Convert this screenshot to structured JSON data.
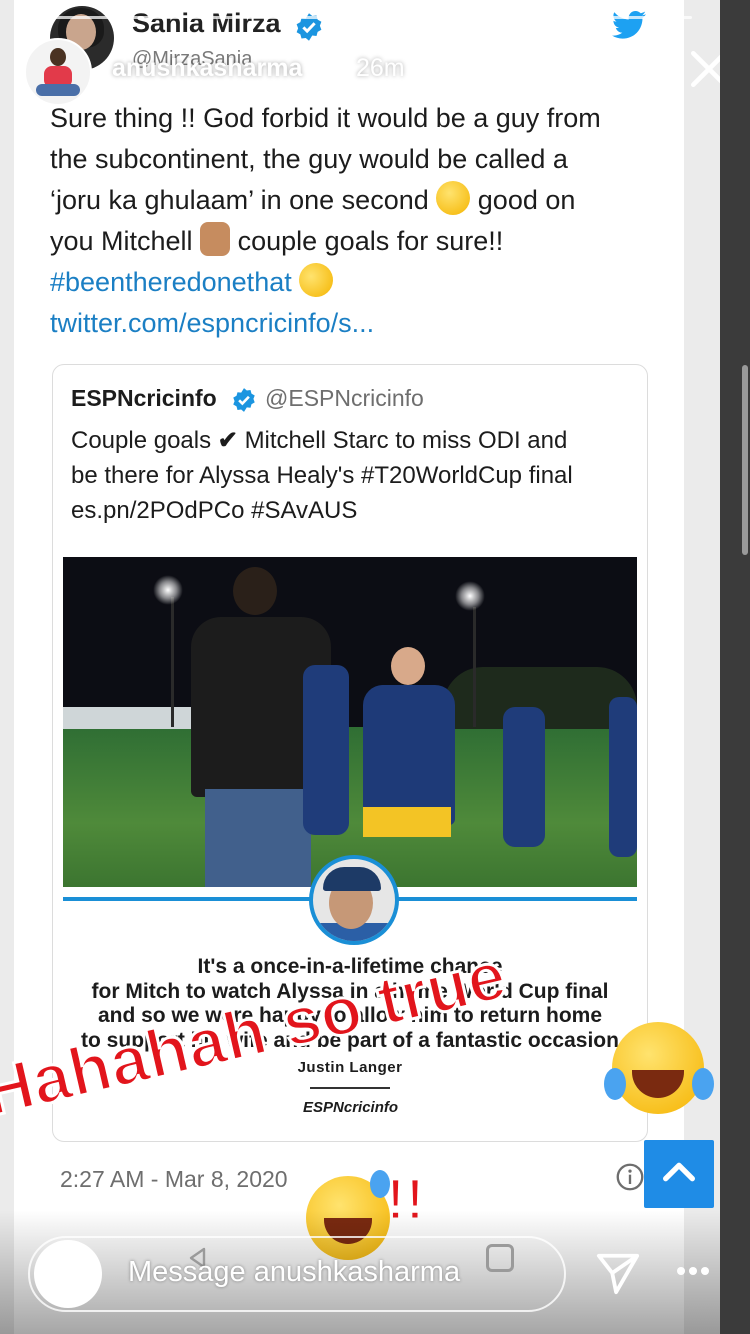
{
  "story": {
    "username": "anushkasharma",
    "time_ago": "26m",
    "close_icon": "close-icon",
    "progress_segments": 4
  },
  "tweet": {
    "author_name": "Sania Mirza",
    "author_handle": "@MirzaSania",
    "lines": [
      "Sure thing !! God forbid it would be a guy from",
      "the subcontinent, the guy would be called a",
      "‘joru ka ghulaam’ in one second",
      "good on",
      "you Mitchell",
      "couple goals for sure!!",
      "#beentheredonethat",
      "twitter.com/espncricinfo/s..."
    ],
    "timestamp": "2:27 AM - Mar 8, 2020"
  },
  "quoted_tweet": {
    "author_name": "ESPNcricinfo",
    "author_handle": "@ESPNcricinfo",
    "lines": [
      "Couple goals",
      "✔",
      "Mitchell Starc to miss ODI and",
      "be there for Alyssa Healy's #T20WorldCup final",
      "es.pn/2POdPCo #SAvAUS"
    ],
    "pull_quote": [
      "It's a once-in-a-lifetime chance",
      "for Mitch to watch Alyssa in a home World Cup final",
      "and so we were happy to allow him to return home",
      "to support his wife and be part of a fantastic occasion"
    ],
    "quote_author": "Justin Langer",
    "brand": "ESPNcricinfo"
  },
  "sticker": {
    "text": "Hahahah so true",
    "exclaim": "!!",
    "color": "#e2151c"
  },
  "reply_bar": {
    "placeholder": "Message anushkasharma",
    "send_icon": "send-icon",
    "more_icon": "more-icon"
  },
  "colors": {
    "link_blue": "#1b7fc4",
    "accent_blue": "#1a8fd6",
    "scroll_button": "#1f8ce6"
  }
}
